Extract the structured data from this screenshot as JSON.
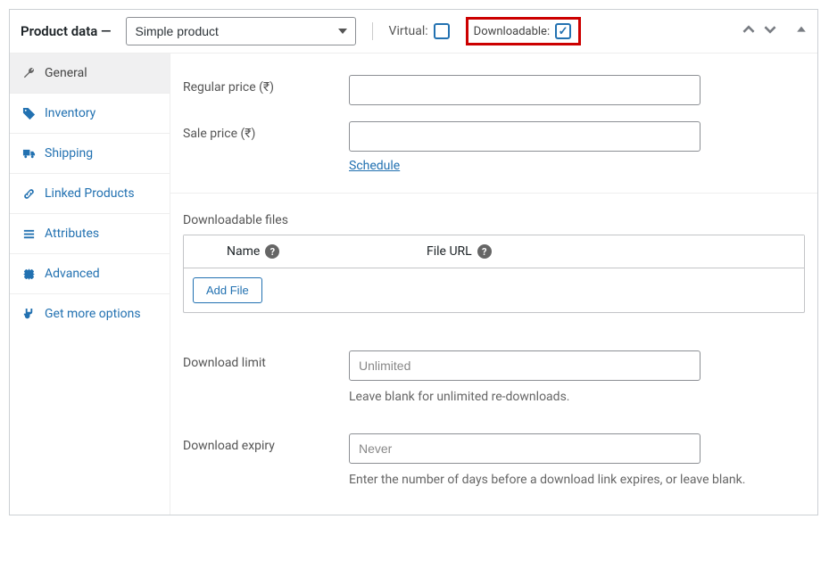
{
  "header": {
    "title": "Product data —",
    "product_type": "Simple product",
    "virtual_label": "Virtual:",
    "downloadable_label": "Downloadable:"
  },
  "sidebar": {
    "items": [
      {
        "label": "General"
      },
      {
        "label": "Inventory"
      },
      {
        "label": "Shipping"
      },
      {
        "label": "Linked Products"
      },
      {
        "label": "Attributes"
      },
      {
        "label": "Advanced"
      },
      {
        "label": "Get more options"
      }
    ]
  },
  "fields": {
    "regular_price_label": "Regular price (₹)",
    "sale_price_label": "Sale price (₹)",
    "schedule_link": "Schedule",
    "downloadable_files_label": "Downloadable files",
    "name_col": "Name",
    "url_col": "File URL",
    "add_file_btn": "Add File",
    "download_limit_label": "Download limit",
    "download_limit_placeholder": "Unlimited",
    "download_limit_help": "Leave blank for unlimited re-downloads.",
    "download_expiry_label": "Download expiry",
    "download_expiry_placeholder": "Never",
    "download_expiry_help": "Enter the number of days before a download link expires, or leave blank."
  }
}
